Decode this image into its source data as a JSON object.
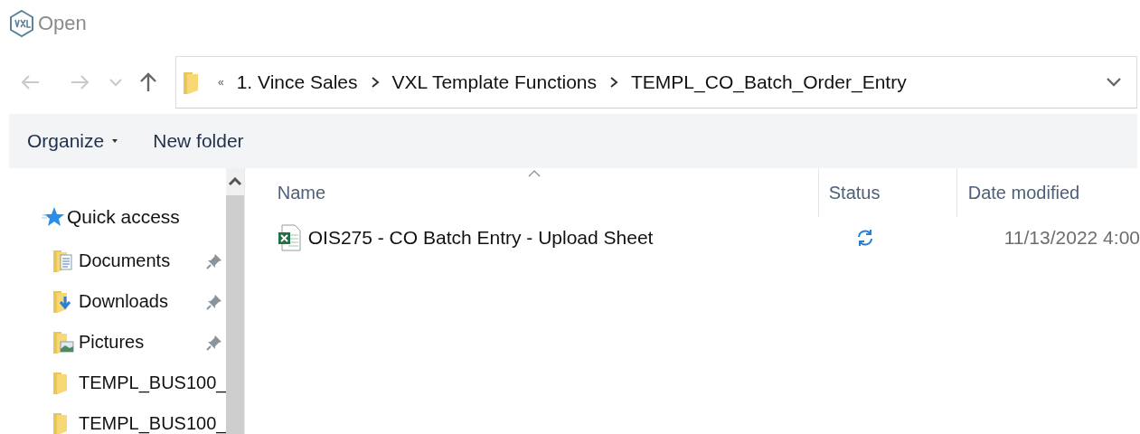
{
  "window": {
    "title": "Open"
  },
  "nav": [
    {
      "kind": "back",
      "disabled": true
    },
    {
      "kind": "forward",
      "disabled": true
    },
    {
      "kind": "recent",
      "disabled": true
    },
    {
      "kind": "up",
      "disabled": false
    }
  ],
  "address": {
    "overflow": "«",
    "crumbs": [
      "1. Vince Sales",
      "VXL Template Functions",
      "TEMPL_CO_Batch_Order_Entry"
    ]
  },
  "toolbar": [
    {
      "label": "Organize",
      "dropdown": true
    },
    {
      "label": "New folder",
      "dropdown": false
    }
  ],
  "sidebar": {
    "header": "Quick access",
    "items": [
      {
        "label": "Documents",
        "kind": "documents",
        "pinned": true
      },
      {
        "label": "Downloads",
        "kind": "downloads",
        "pinned": true
      },
      {
        "label": "Pictures",
        "kind": "pictures",
        "pinned": true
      },
      {
        "label": "TEMPL_BUS100_",
        "kind": "folder",
        "pinned": false
      },
      {
        "label": "TEMPL_BUS100_",
        "kind": "folder",
        "pinned": false
      }
    ]
  },
  "table": {
    "columns": [
      {
        "label": "Name",
        "sorted": true
      },
      {
        "label": "Status",
        "sorted": false
      },
      {
        "label": "Date modified",
        "sorted": false
      }
    ],
    "rows": [
      {
        "name": "OIS275 - CO Batch Entry - Upload Sheet",
        "kind": "excel",
        "syncing": true,
        "date": "11/13/2022 4:00",
        "selected": false
      }
    ]
  }
}
